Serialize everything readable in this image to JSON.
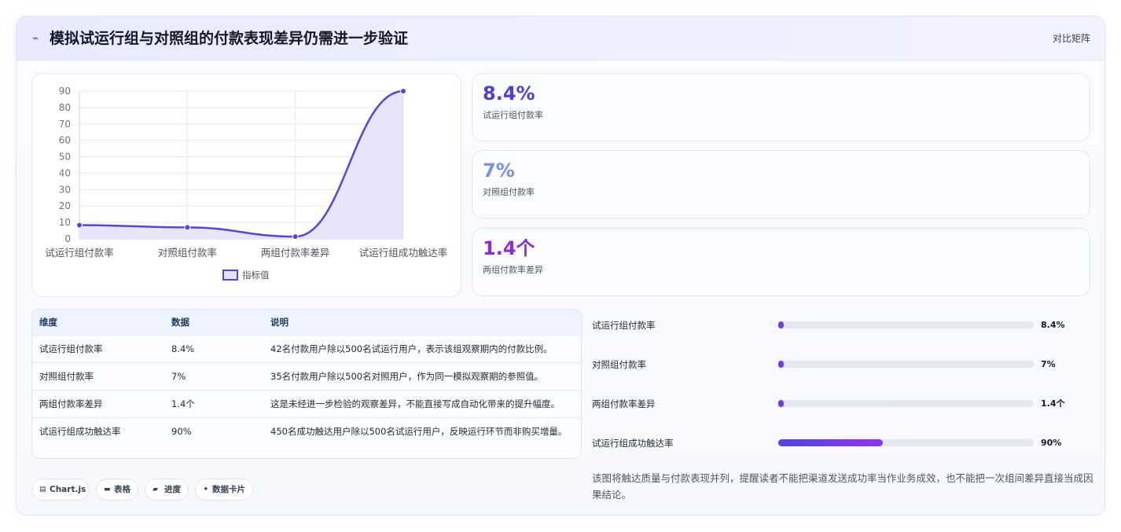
{
  "header": {
    "icon": "trend-icon",
    "title": "模拟试运行组与对照组的付款表现差异仍需进一步验证",
    "right_label": "对比矩阵"
  },
  "chart_data": {
    "type": "area",
    "categories": [
      "试运行组付款率",
      "对照组付款率",
      "两组付款率差异",
      "试运行组成功触达率"
    ],
    "series": [
      {
        "name": "指标值",
        "values": [
          8.4,
          7,
          1.4,
          90
        ]
      }
    ],
    "ylim": [
      0,
      90
    ],
    "yticks": [
      0,
      10,
      20,
      30,
      40,
      50,
      60,
      70,
      80,
      90
    ],
    "grid": true,
    "legend": "bottom",
    "colors": {
      "line": "#5446d8",
      "fill": "#e4e1fa"
    }
  },
  "kpis": [
    {
      "value": "8.4%",
      "label": "试运行组付款率",
      "color": "#4f3fd6"
    },
    {
      "value": "7%",
      "label": "对照组付款率",
      "color": "#7b8ce6"
    },
    {
      "value": "1.4个",
      "label": "两组付款率差异",
      "color": "#8b2bd9"
    }
  ],
  "table": {
    "headers": [
      "维度",
      "数据",
      "说明"
    ],
    "rows": [
      [
        "试运行组付款率",
        "8.4%",
        "42名付款用户除以500名试运行用户，表示该组观察期内的付款比例。"
      ],
      [
        "对照组付款率",
        "7%",
        "35名付款用户除以500名对照用户，作为同一模拟观察期的参照值。"
      ],
      [
        "两组付款率差异",
        "1.4个",
        "这是未经进一步检验的观察差异，不能直接写成自动化带来的提升幅度。"
      ],
      [
        "试运行组成功触达率",
        "90%",
        "450名成功触达用户除以500名试运行用户，反映运行环节而非购买增量。"
      ]
    ]
  },
  "bars": [
    {
      "label": "试运行组付款率",
      "value": "8.4%",
      "fraction": 0.02
    },
    {
      "label": "对照组付款率",
      "value": "7%",
      "fraction": 0.02
    },
    {
      "label": "两组付款率差异",
      "value": "1.4个",
      "fraction": 0.02
    },
    {
      "label": "试运行组成功触达率",
      "value": "90%",
      "fraction": 0.41
    }
  ],
  "note": "该图将触达质量与付款表现并列，提醒读者不能把渠道发送成功率当作业务成效，也不能把一次组间差异直接当成因果结论。",
  "chips": [
    {
      "icon": "chart-icon",
      "label": "Chart.js"
    },
    {
      "icon": "table-icon",
      "label": "表格"
    },
    {
      "icon": "progress-icon",
      "label": "进度"
    },
    {
      "icon": "card-icon",
      "label": "数据卡片"
    }
  ]
}
